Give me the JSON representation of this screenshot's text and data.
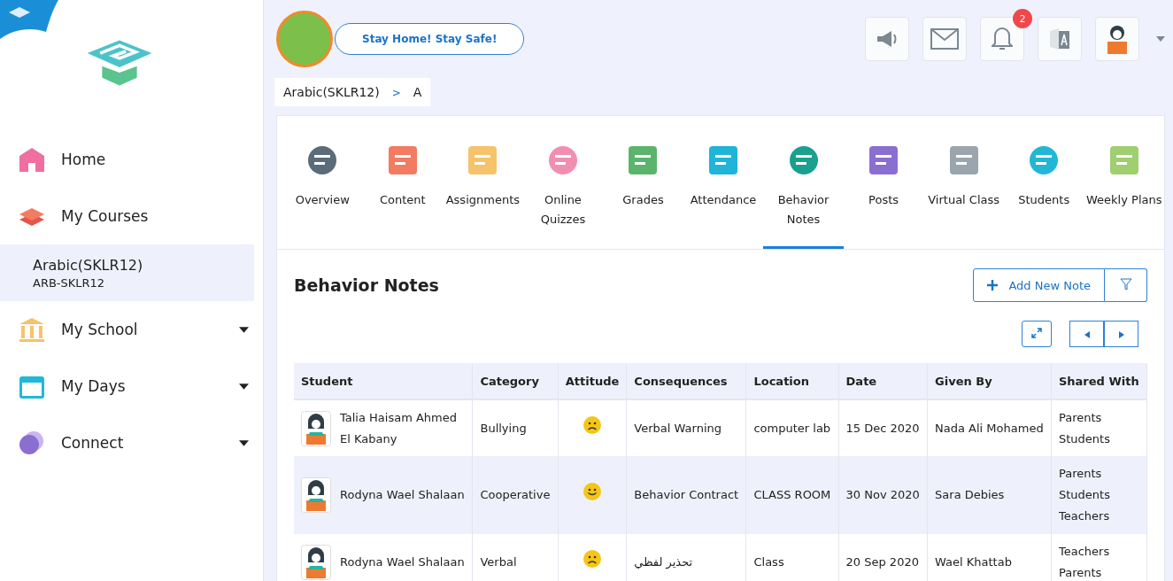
{
  "sidebar": {
    "items": [
      {
        "label": "Home",
        "kind": "home",
        "expandable": false,
        "selected": false
      },
      {
        "label": "My Courses",
        "kind": "courses",
        "expandable": false,
        "selected": false
      },
      {
        "label": "Arabic(SKLR12)",
        "sublabel": "ARB-SKLR12",
        "kind": "course",
        "selected": true
      },
      {
        "label": "My School",
        "kind": "school",
        "expandable": true,
        "selected": false
      },
      {
        "label": "My Days",
        "kind": "days",
        "expandable": true,
        "selected": false
      },
      {
        "label": "Connect",
        "kind": "connect",
        "expandable": true,
        "selected": false
      }
    ]
  },
  "banner": {
    "label": "Stay Home! Stay Safe!"
  },
  "header": {
    "notification_count": "2"
  },
  "breadcrumb": [
    {
      "label": "Arabic(SKLR12)"
    },
    {
      "label": ">"
    },
    {
      "label": "A"
    }
  ],
  "tabs": [
    {
      "label": "Overview",
      "selected": false
    },
    {
      "label": "Content",
      "selected": false
    },
    {
      "label": "Assignments",
      "selected": false
    },
    {
      "label": "Online Quizzes",
      "selected": false
    },
    {
      "label": "Grades",
      "selected": false
    },
    {
      "label": "Attendance",
      "selected": false
    },
    {
      "label": "Behavior Notes",
      "selected": true
    },
    {
      "label": "Posts",
      "selected": false
    },
    {
      "label": "Virtual Class",
      "selected": false
    },
    {
      "label": "Students",
      "selected": false
    },
    {
      "label": "Weekly Plans",
      "selected": false
    }
  ],
  "section": {
    "title": "Behavior Notes",
    "add_button": "Add New Note"
  },
  "table": {
    "columns": [
      "Student",
      "Category",
      "Attitude",
      "Consequences",
      "Location",
      "Date",
      "Given By",
      "Shared With"
    ],
    "rows": [
      {
        "student": "Talia Haisam Ahmed El Kabany",
        "category": "Bullying",
        "attitude": {
          "kind": "sad"
        },
        "consequences": "Verbal Warning",
        "location": "computer lab",
        "date": "15 Dec 2020",
        "given_by": "Nada Ali Mohamed",
        "shared_with": [
          "Parents",
          "Students"
        ]
      },
      {
        "student": "Rodyna Wael Shalaan",
        "category": "Cooperative",
        "attitude": {
          "kind": "happy"
        },
        "consequences": "Behavior Contract",
        "location": "CLASS ROOM",
        "date": "30 Nov 2020",
        "given_by": "Sara Debies",
        "shared_with": [
          "Parents",
          "Students",
          "Teachers"
        ]
      },
      {
        "student": "Rodyna Wael Shalaan",
        "category": "Verbal",
        "attitude": {
          "kind": "sad"
        },
        "consequences": "تحذير لفظي",
        "location": "Class",
        "date": "20 Sep 2020",
        "given_by": "Wael Khattab",
        "shared_with": [
          "Teachers",
          "Parents"
        ]
      }
    ]
  }
}
